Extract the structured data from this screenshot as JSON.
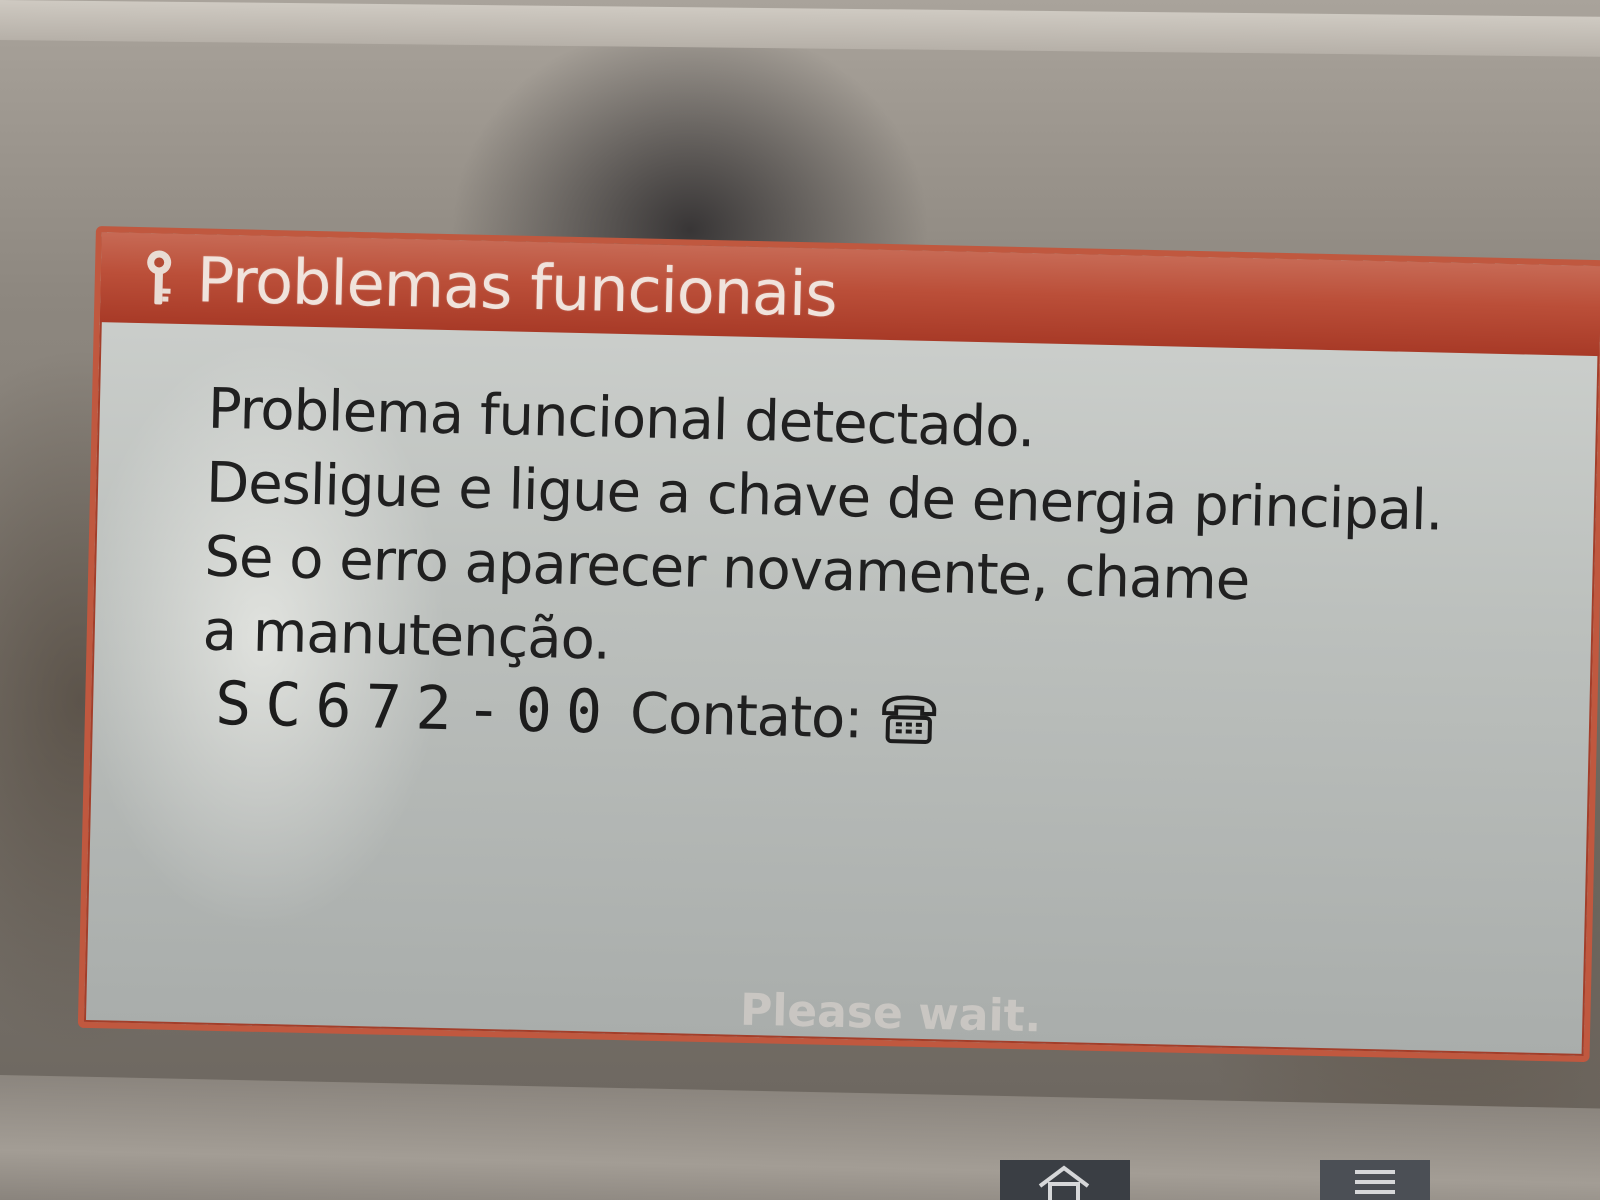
{
  "dialog": {
    "title": "Problemas funcionais",
    "title_icon": "wrench-icon",
    "message_lines": [
      "Problema funcional detectado.",
      "Desligue e ligue a chave de energia principal.",
      "Se o erro aparecer novamente, chame",
      "a manutenção."
    ],
    "error_code": "SC672-00",
    "contact_label": "Contato:",
    "contact_icon": "telephone-icon"
  },
  "status_text": "Please wait.",
  "colors": {
    "title_bar": "#bb4f39",
    "dialog_border": "#c0583f",
    "dialog_background": "#c4c8c5",
    "text": "#202020",
    "status_text": "#c9c6c2"
  }
}
